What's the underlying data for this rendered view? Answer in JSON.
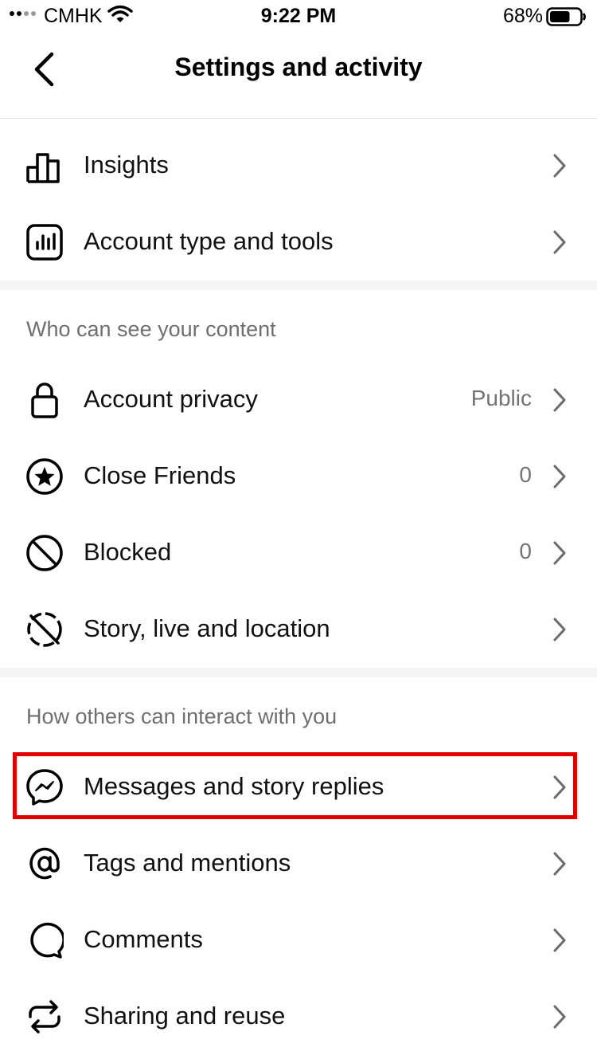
{
  "status_bar": {
    "carrier": "CMHK",
    "time": "9:22 PM",
    "battery_percent": "68%",
    "battery_level": 0.68
  },
  "header": {
    "title": "Settings and activity",
    "back_icon": "chevron-left-icon"
  },
  "group_top": {
    "items": [
      {
        "label": "Insights",
        "icon": "bar-chart-icon"
      },
      {
        "label": "Account type and tools",
        "icon": "chart-square-icon"
      }
    ]
  },
  "section_visibility": {
    "header": "Who can see your content",
    "items": [
      {
        "label": "Account privacy",
        "value": "Public",
        "icon": "lock-icon"
      },
      {
        "label": "Close Friends",
        "value": "0",
        "icon": "star-circle-icon"
      },
      {
        "label": "Blocked",
        "value": "0",
        "icon": "blocked-icon"
      },
      {
        "label": "Story, live and location",
        "icon": "story-hidden-icon"
      }
    ]
  },
  "section_interaction": {
    "header": "How others can interact with you",
    "items": [
      {
        "label": "Messages and story replies",
        "icon": "messenger-icon",
        "highlighted": true
      },
      {
        "label": "Tags and mentions",
        "icon": "at-sign-icon"
      },
      {
        "label": "Comments",
        "icon": "comment-bubble-icon"
      },
      {
        "label": "Sharing and reuse",
        "icon": "repost-icon"
      }
    ]
  },
  "colors": {
    "highlight_border": "#e10000",
    "secondary_text": "#737373",
    "section_header": "#6f6f6f",
    "divider": "#f5f5f5"
  }
}
